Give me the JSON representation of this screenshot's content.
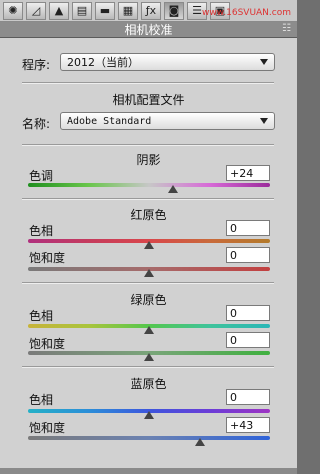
{
  "toolbar": {
    "icons": [
      "aperture-icon",
      "histogram-icon",
      "triangle-icon",
      "hsl-icon",
      "split-tone-icon",
      "detail-icon",
      "fx-icon",
      "camera-calibration-icon",
      "presets-icon",
      "snapshots-icon"
    ]
  },
  "watermark": "www.16SVUAN.com",
  "panel": {
    "title": "相机校准",
    "process_label": "程序:",
    "process_value": "2012（当前）",
    "profile_section": "相机配置文件",
    "name_label": "名称:",
    "name_value": "Adobe Standard"
  },
  "shadows": {
    "title": "阴影",
    "tint_label": "色调",
    "tint_value": "+24",
    "tint_level": 0.6
  },
  "red": {
    "title": "红原色",
    "hue_label": "色相",
    "hue_value": "0",
    "hue_level": 0.5,
    "sat_label": "饱和度",
    "sat_value": "0",
    "sat_level": 0.5
  },
  "green": {
    "title": "绿原色",
    "hue_label": "色相",
    "hue_value": "0",
    "hue_level": 0.5,
    "sat_label": "饱和度",
    "sat_value": "0",
    "sat_level": 0.5
  },
  "blue": {
    "title": "蓝原色",
    "hue_label": "色相",
    "hue_value": "0",
    "hue_level": 0.5,
    "sat_label": "饱和度",
    "sat_value": "+43",
    "sat_level": 0.71
  }
}
